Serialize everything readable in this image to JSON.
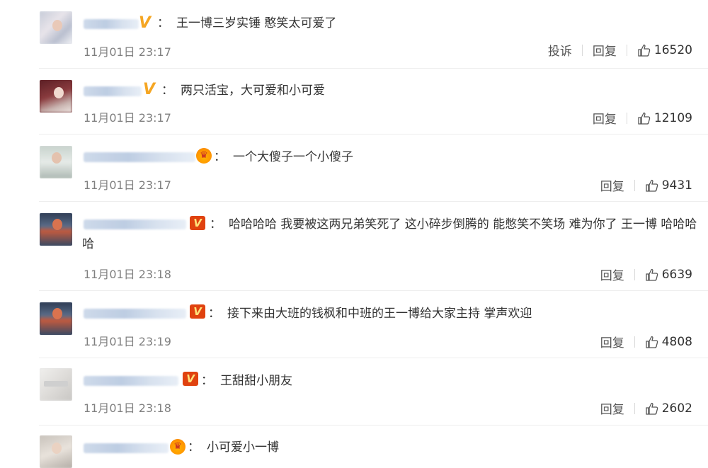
{
  "comments": [
    {
      "badge": "v",
      "badge_icon": "v-verified-icon",
      "text": "王一博三岁实锤 憨笑太可爱了",
      "time": "11月01日 23:17",
      "report": "投诉",
      "reply": "回复",
      "likes": "16520"
    },
    {
      "badge": "v",
      "badge_icon": "v-verified-icon",
      "text": "两只活宝，大可爱和小可爱",
      "time": "11月01日 23:17",
      "reply": "回复",
      "likes": "12109"
    },
    {
      "badge": "crown",
      "badge_icon": "crown-icon",
      "text": "一个大傻子一个小傻子",
      "time": "11月01日 23:17",
      "reply": "回复",
      "likes": "9431"
    },
    {
      "badge": "vip",
      "badge_icon": "vip-icon",
      "text": "哈哈哈哈 我要被这两兄弟笑死了 这小碎步倒腾的 能憋笑不笑场 难为你了 王一博 哈哈哈哈",
      "time": "11月01日 23:18",
      "reply": "回复",
      "likes": "6639"
    },
    {
      "badge": "vip",
      "badge_icon": "vip-icon",
      "text": "接下来由大班的钱枫和中班的王一博给大家主持 掌声欢迎",
      "time": "11月01日 23:19",
      "reply": "回复",
      "likes": "4808"
    },
    {
      "badge": "vip",
      "badge_icon": "vip-icon",
      "text": "王甜甜小朋友",
      "time": "11月01日 23:18",
      "reply": "回复",
      "likes": "2602"
    },
    {
      "badge": "crown",
      "badge_icon": "crown-icon",
      "text": "小可爱小一博"
    }
  ],
  "separator": "：",
  "colors": {
    "text": "#333333",
    "time": "#808080",
    "v_badge": "#f5a623",
    "vip_badge": "#e0420f",
    "divider": "#eeeeee"
  }
}
